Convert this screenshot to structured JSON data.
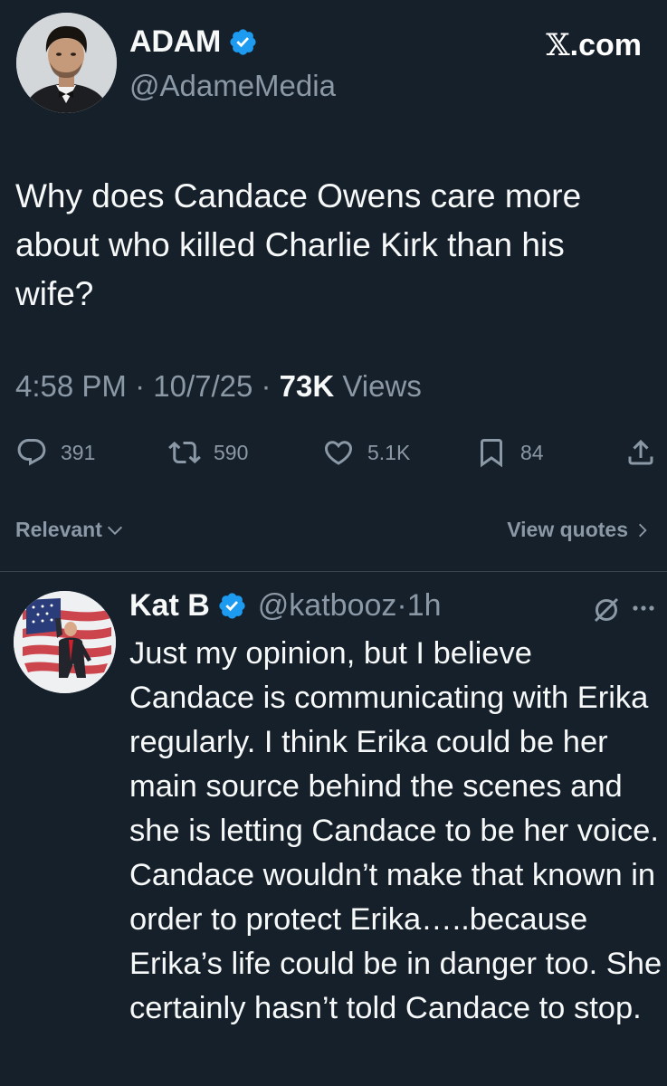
{
  "main_tweet": {
    "display_name": "ADAM",
    "handle": "@AdameMedia",
    "brand": ".com",
    "brand_x": "𝕏",
    "text": "Why does Candace Owens care more about who killed Charlie Kirk than his wife?",
    "time": "4:58 PM",
    "sep1": " · ",
    "date": "10/7/25",
    "sep2": " · ",
    "views_count": "73K",
    "views_label": " Views",
    "replies": "391",
    "reposts": "590",
    "likes": "5.1K",
    "bookmarks": "84"
  },
  "sort": {
    "label": "Relevant",
    "view_quotes": "View quotes"
  },
  "reply": {
    "display_name": "Kat B",
    "handle": "@katbooz",
    "dot": "·",
    "time": "1h",
    "text": "Just my opinion, but I believe Candace is communicating with Erika regularly. I think Erika could be her main source behind the scenes and she is letting Candace to be her voice. Candace wouldn’t make that known in order to protect Erika…..because Erika’s life could be in danger too. She certainly hasn’t told Candace to stop."
  },
  "colors": {
    "background": "#15202b",
    "text_primary": "#f7f9f9",
    "text_secondary": "#8b98a5",
    "verified": "#1d9bf0",
    "divider": "#38444d"
  },
  "icons": [
    "verified-badge-icon",
    "reply-icon",
    "repost-icon",
    "like-icon",
    "bookmark-icon",
    "share-icon",
    "chevron-down-icon",
    "chevron-right-icon",
    "grok-icon",
    "more-icon"
  ]
}
